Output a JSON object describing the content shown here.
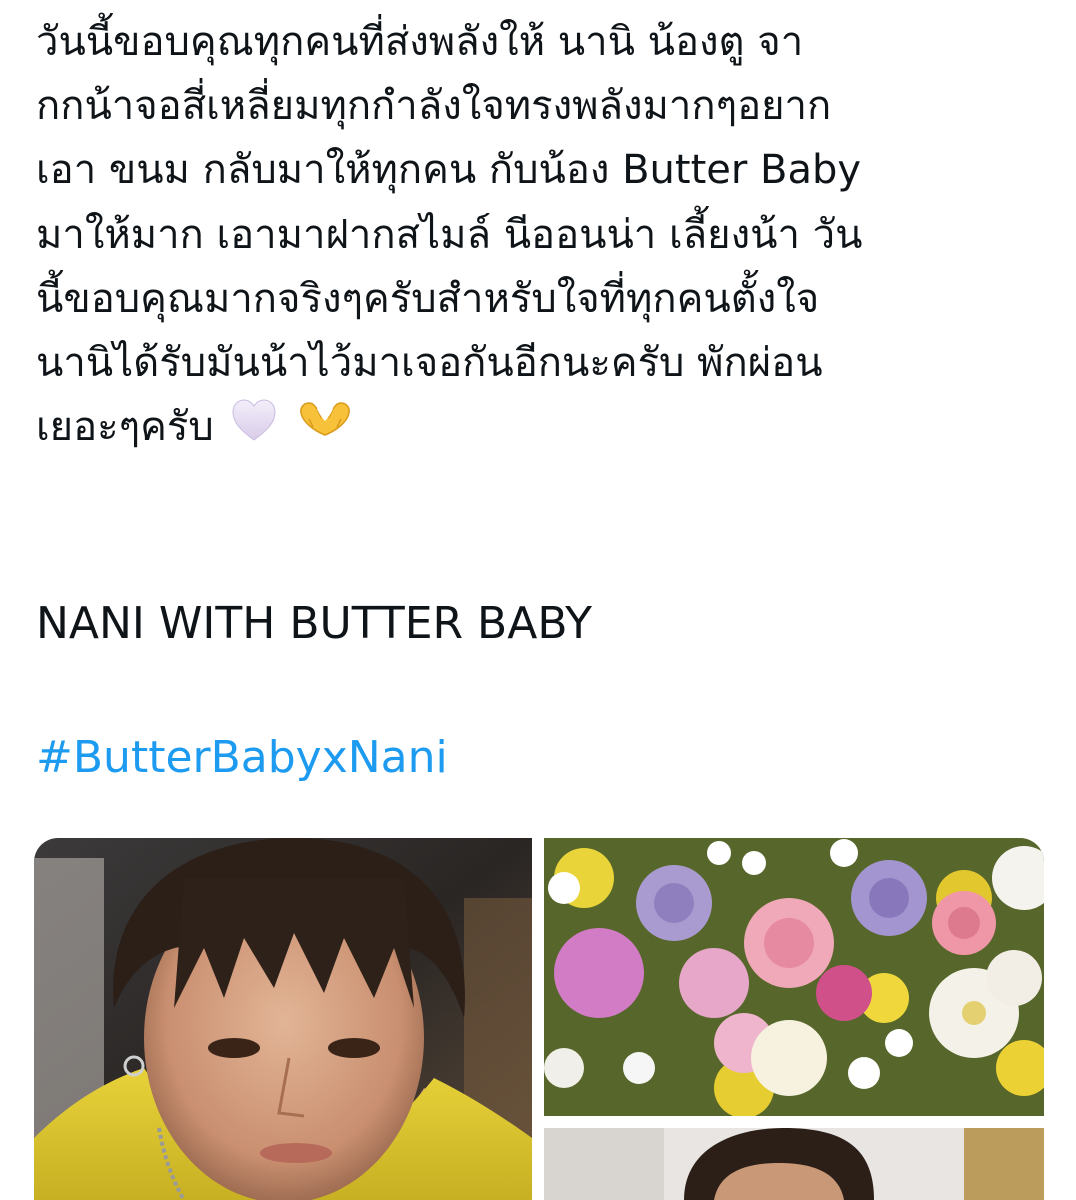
{
  "tweet": {
    "lines": [
      "วันนี้ขอบคุณทุกคนที่ส่งพลังให้ นานิ น้องตู จา",
      "กกน้าจอสี่เหลี่ยมทุกกำลังใจทรงพลังมากๆอยาก",
      "เอา ขนม กลับมาให้ทุกคน กับน้อง Butter Baby",
      "มาให้มาก เอามาฝากสไมล์ นีออนน่า เลี้ยงน้า วัน",
      "นี้ขอบคุณมากจริงๆครับสำหรับใจที่ทุกคนตั้งใจ",
      "นานิได้รับมันน้าไว้มาเจอกันอีกนะครับ พักผ่อน",
      "เยอะๆครับ"
    ],
    "emojis": [
      "white-heart-icon",
      "heart-hands-icon"
    ],
    "headline": "NANI WITH BUTTER BABY",
    "hashtag": "#ButterBabyxNani",
    "link_color": "#1d9bf0",
    "text_color": "#0f1419"
  },
  "media": [
    {
      "name": "photo-selfie-yellow-top"
    },
    {
      "name": "photo-flower-bouquet"
    },
    {
      "name": "photo-selfie-2"
    }
  ]
}
